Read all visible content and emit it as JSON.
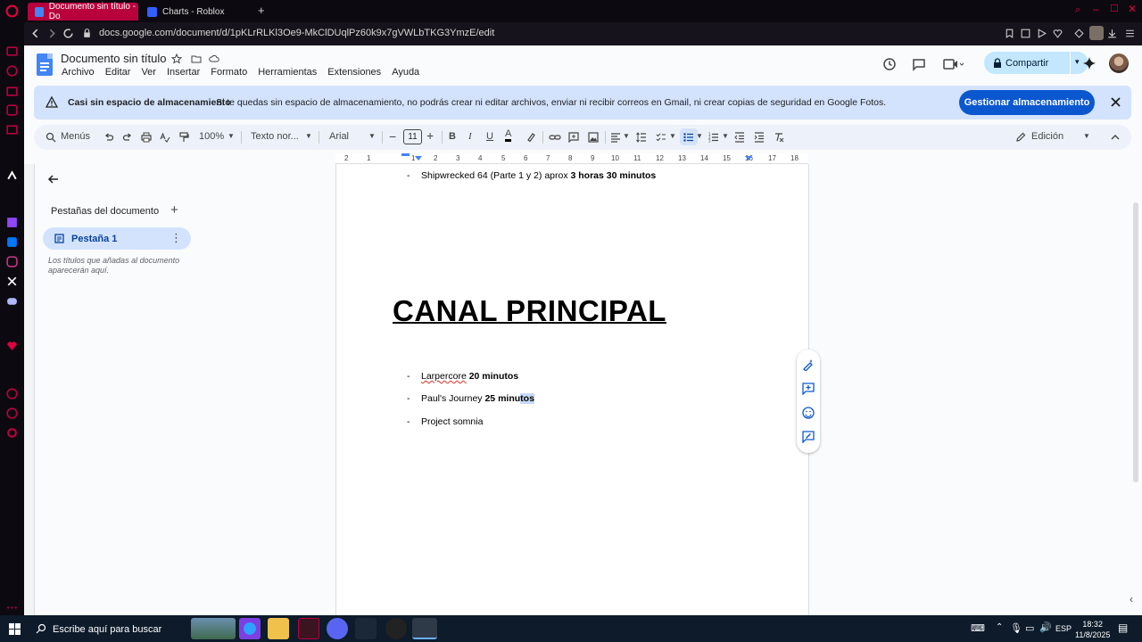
{
  "browser": {
    "tabs": [
      {
        "label": "Documento sin título - Do",
        "active": true
      },
      {
        "label": "Charts - Roblox",
        "active": false
      }
    ],
    "url": "docs.google.com/document/d/1pKLrRLKl3Oe9-MkClDUqlPz60k9x7gVWLbTKG3YmzE/edit"
  },
  "docs": {
    "title": "Documento sin título",
    "menu": [
      "Archivo",
      "Editar",
      "Ver",
      "Insertar",
      "Formato",
      "Herramientas",
      "Extensiones",
      "Ayuda"
    ],
    "share_label": "Compartir"
  },
  "banner": {
    "title": "Casi sin espacio de almacenamiento",
    "text": "Si te quedas sin espacio de almacenamiento, no podrás crear ni editar archivos, enviar ni recibir correos en Gmail, ni crear copias de seguridad en Google Fotos.",
    "button": "Gestionar almacenamiento"
  },
  "toolbar": {
    "menus_label": "Menús",
    "zoom": "100%",
    "style": "Texto nor...",
    "font": "Arial",
    "font_size": "11",
    "mode": "Edición"
  },
  "ruler": {
    "numbers": [
      "2",
      "1",
      "1",
      "2",
      "3",
      "4",
      "5",
      "6",
      "7",
      "8",
      "9",
      "10",
      "11",
      "12",
      "13",
      "14",
      "15",
      "16",
      "17",
      "18"
    ]
  },
  "panel": {
    "title": "Pestañas del documento",
    "tab_label": "Pestaña 1",
    "hint": "Los títulos que añadas al documento aparecerán aquí."
  },
  "document": {
    "line1_plain": "Shipwrecked 64 (Parte 1 y 2) aprox ",
    "line1_bold": "3 horas 30 minutos",
    "heading": "CANAL PRINCIPAL",
    "items": [
      {
        "plain": "Larpercore",
        "bold": " 20 minutos"
      },
      {
        "plain": "Paul's Journey ",
        "bold": "25 minu",
        "bold_selected": "tos"
      },
      {
        "plain": "Project somnia",
        "bold": ""
      }
    ],
    "dash": "-"
  },
  "taskbar": {
    "search_placeholder": "Escribe aquí para buscar",
    "lang": "ESP",
    "time": "18:32",
    "date": "11/8/2025"
  }
}
